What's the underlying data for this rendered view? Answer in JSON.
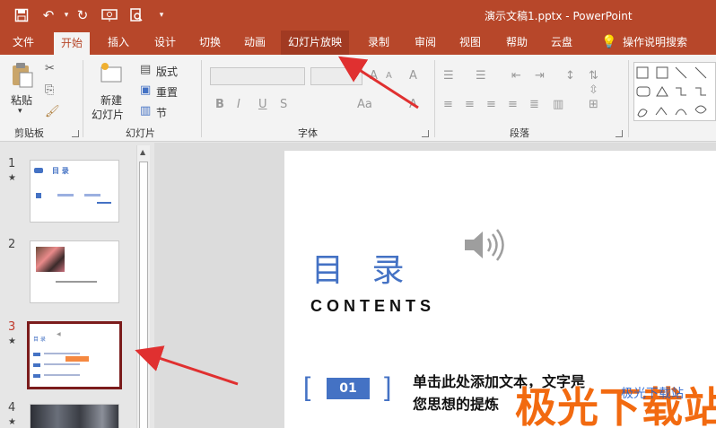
{
  "window": {
    "title": "演示文稿1.pptx - PowerPoint"
  },
  "tabs": [
    {
      "label": "文件"
    },
    {
      "label": "开始"
    },
    {
      "label": "插入"
    },
    {
      "label": "设计"
    },
    {
      "label": "切换"
    },
    {
      "label": "动画"
    },
    {
      "label": "幻灯片放映"
    },
    {
      "label": "录制"
    },
    {
      "label": "审阅"
    },
    {
      "label": "视图"
    },
    {
      "label": "帮助"
    },
    {
      "label": "云盘"
    },
    {
      "label": "操作说明搜索"
    }
  ],
  "ribbon": {
    "clipboard": {
      "paste": "粘贴",
      "group": "剪贴板"
    },
    "slides": {
      "new_slide_1": "新建",
      "new_slide_2": "幻灯片",
      "layout": "版式",
      "reset": "重置",
      "section": "节",
      "group": "幻灯片"
    },
    "font": {
      "group": "字体",
      "bold": "B",
      "italic": "I",
      "underline": "U",
      "strike": "S",
      "clear": "A",
      "size_inc": "A",
      "size_dec": "A",
      "case": "Aa",
      "highlight": "A"
    },
    "paragraph": {
      "group": "段落"
    }
  },
  "thumbnails": [
    {
      "number": "1",
      "title": "目   录"
    },
    {
      "number": "2"
    },
    {
      "number": "3",
      "title": "目 录"
    },
    {
      "number": "4"
    }
  ],
  "slide": {
    "title": "目 录",
    "subtitle": "CONTENTS",
    "item_number": "01",
    "item_line1": "单击此处添加文本，文字是",
    "item_line2": "您思想的提炼"
  },
  "watermark": {
    "main": "极光下载站",
    "small": "极光下载站"
  },
  "colors": {
    "brand": "#b7472a",
    "accent": "#4472c4",
    "selection": "#7b1c1c",
    "arrow": "#e03030",
    "watermark": "#f26a10"
  }
}
